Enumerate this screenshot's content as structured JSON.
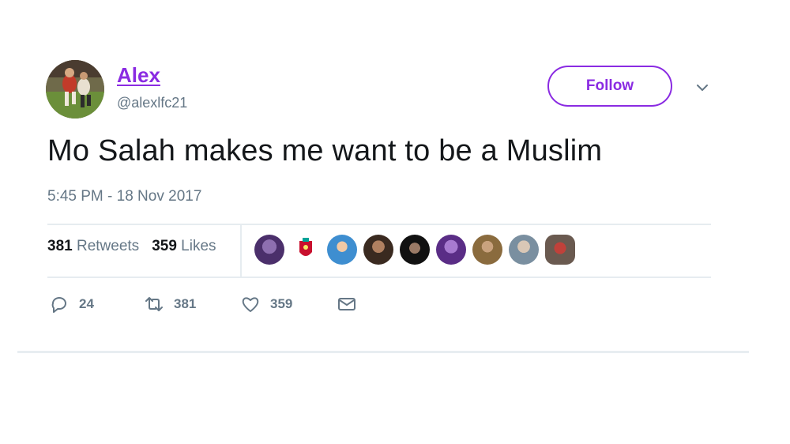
{
  "user": {
    "name": "Alex",
    "handle": "@alexlfc21"
  },
  "follow_button": {
    "label": "Follow"
  },
  "tweet": {
    "text": "Mo Salah makes me want to be a Muslim",
    "timestamp": "5:45 PM - 18 Nov 2017"
  },
  "stats": {
    "retweets_count": "381",
    "retweets_label": "Retweets",
    "likes_count": "359",
    "likes_label": "Likes"
  },
  "actions": {
    "replies": "24",
    "retweets": "381",
    "likes": "359"
  },
  "colors": {
    "accent": "#8a2be2",
    "secondary_text": "#657786",
    "divider": "#e6ecf0"
  },
  "icons": [
    "reply-icon",
    "retweet-icon",
    "heart-icon",
    "envelope-icon",
    "chevron-down-icon"
  ]
}
